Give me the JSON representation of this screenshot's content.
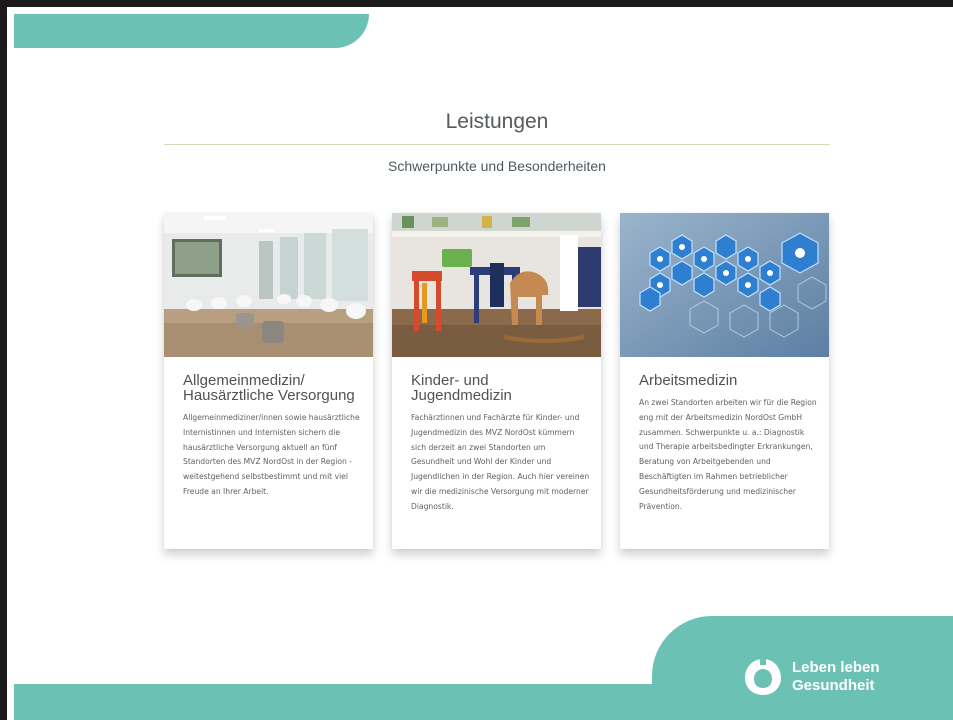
{
  "page": {
    "title": "Leistungen",
    "subtitle": "Schwerpunkte und Besonderheiten"
  },
  "cards": [
    {
      "title": "Allgemeinmedizin/ Hausärztliche Versorgung",
      "text": "Allgemeinmediziner/innen sowie hausärztliche Internistinnen und Internisten sichern die hausärztliche Versorgung aktuell an fünf Standorten des MVZ NordOst in der Region - weitestgehend selbstbestimmt und mit viel Freude an Ihrer Arbeit.",
      "image": "waiting-room-photo"
    },
    {
      "title": "Kinder- und Jugendmedizin",
      "text": "Fachärztinnen und Fachärzte für Kinder- und Jugendmedizin des MVZ NordOst kümmern sich derzeit an zwei Standorten um Gesundheit und Wohl der Kinder und Jugendlichen in der Region. Auch hier vereinen wir die medizinische Versorgung mit moderner Diagnostik.",
      "image": "children-playroom-photo"
    },
    {
      "title": "Arbeitsmedizin",
      "text": "An zwei Standorten arbeiten wir für die Region eng mit der Arbeitsmedizin NordOst GmbH zusammen. Schwerpunkte u. a.: Diagnostik und Therapie arbeitsbedingter Erkrankungen, Beratung von Arbeitgebenden und Beschäftigten im Rahmen betrieblicher Gesundheitsförderung und medizinischer Prävention.",
      "image": "hexagon-icons-graphic"
    }
  ],
  "brand": {
    "line1": "Leben leben",
    "line2": "Gesundheit"
  },
  "colors": {
    "accent": "#6cc1b5",
    "divider": "#d8d9b4",
    "text": "#5d6266"
  }
}
